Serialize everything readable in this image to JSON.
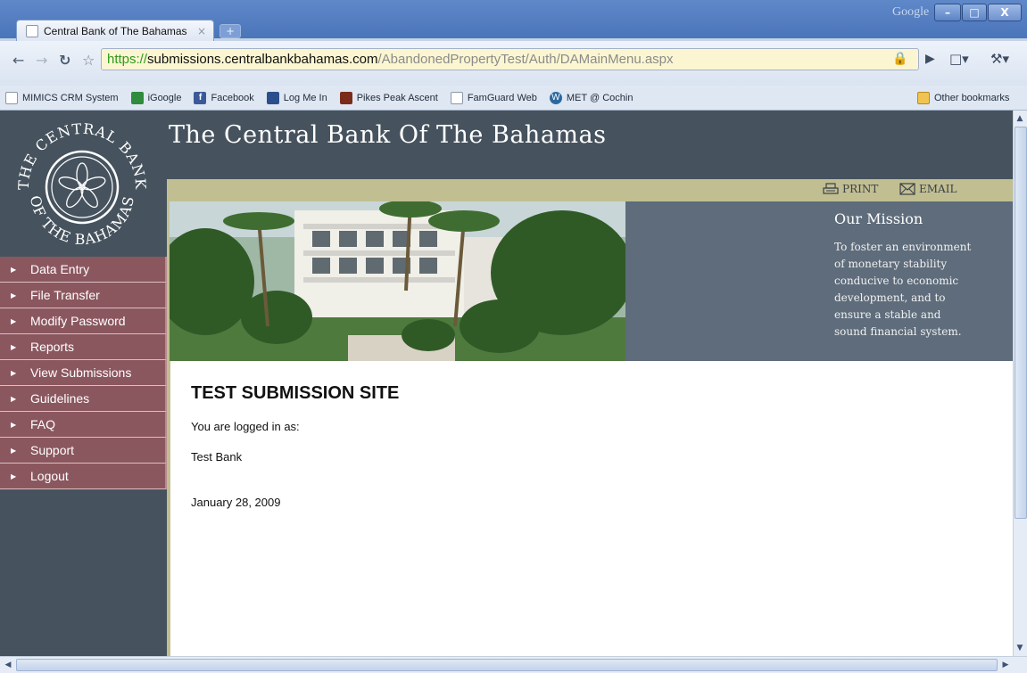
{
  "browser": {
    "tab_title": "Central Bank of The Bahamas",
    "tab_close": "×",
    "new_tab": "+",
    "window_label": "Google",
    "controls": {
      "minimize": "–",
      "maximize": "□",
      "close": "X"
    },
    "url": {
      "scheme": "https://",
      "host": "submissions.centralbankbahamas.com",
      "path": "/AbandonedPropertyTest/Auth/DAMainMenu.aspx"
    },
    "bookmarks": [
      {
        "label": "MIMICS CRM System",
        "icon": "page-icon"
      },
      {
        "label": "iGoogle",
        "icon": "igoogle-icon"
      },
      {
        "label": "Facebook",
        "icon": "facebook-icon"
      },
      {
        "label": "Log Me In",
        "icon": "logmein-icon"
      },
      {
        "label": "Pikes Peak Ascent",
        "icon": "pikes-peak-icon"
      },
      {
        "label": "FamGuard Web",
        "icon": "page-icon"
      },
      {
        "label": "MET @ Cochin",
        "icon": "wordpress-icon"
      }
    ],
    "other_bookmarks": "Other bookmarks"
  },
  "site": {
    "logo_text": {
      "top": "THE CENTRAL BANK",
      "bottom": "OF THE BAHAMAS"
    },
    "title": "The Central Bank Of The Bahamas",
    "print_label": "PRINT",
    "email_label": "EMAIL",
    "mission": {
      "title": "Our Mission",
      "lines": [
        "To foster an environment",
        "of monetary stability",
        "conducive to economic",
        "development, and to",
        "ensure a stable and",
        "sound financial system."
      ]
    },
    "nav": [
      "Data Entry",
      "File Transfer",
      "Modify Password",
      "Reports",
      "View Submissions",
      "Guidelines",
      "FAQ",
      "Support",
      "Logout"
    ]
  },
  "content": {
    "heading": "TEST SUBMISSION SITE",
    "logged_in_label": "You are logged in as:",
    "user": "Test Bank",
    "date": "January 28, 2009"
  },
  "colors": {
    "header": "#46535e",
    "nav_item": "#8b575f",
    "tool_band": "#c1bf92",
    "mission": "#5e6c7b"
  }
}
